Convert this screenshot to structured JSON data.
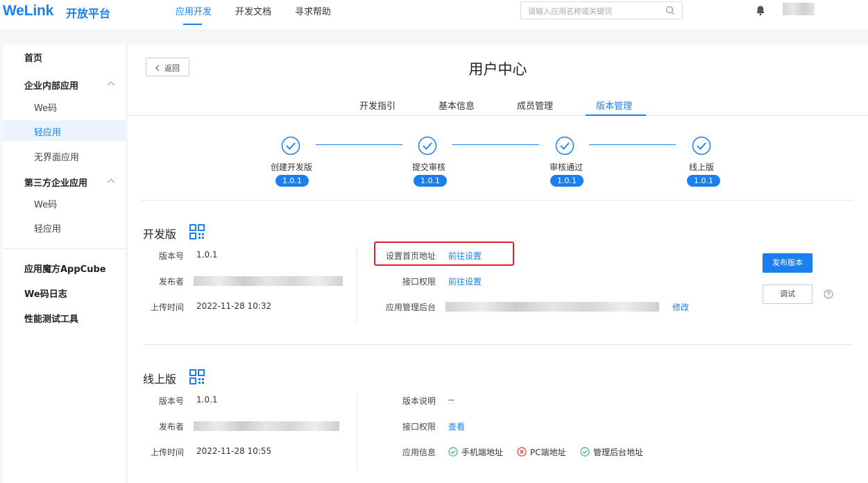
{
  "header": {
    "logo": "WeLink",
    "logo_sub": "开放平台",
    "nav": [
      "应用开发",
      "开发文档",
      "寻求帮助"
    ],
    "search_placeholder": "请输入应用名称或关键词"
  },
  "sidebar": {
    "items": [
      {
        "label": "首页"
      },
      {
        "label": "企业内部应用"
      },
      {
        "label": "We码"
      },
      {
        "label": "轻应用"
      },
      {
        "label": "无界面应用"
      },
      {
        "label": "第三方企业应用"
      },
      {
        "label": "We码"
      },
      {
        "label": "轻应用"
      },
      {
        "label": "应用魔方AppCube"
      },
      {
        "label": "We码日志"
      },
      {
        "label": "性能测试工具"
      }
    ]
  },
  "page": {
    "back": "返回",
    "title": "用户中心",
    "tabs": [
      "开发指引",
      "基本信息",
      "成员管理",
      "版本管理"
    ]
  },
  "steps": [
    {
      "label": "创建开发版",
      "version": "1.0.1"
    },
    {
      "label": "提交审核",
      "version": "1.0.1"
    },
    {
      "label": "审核通过",
      "version": "1.0.1"
    },
    {
      "label": "线上版",
      "version": "1.0.1"
    }
  ],
  "dev": {
    "title": "开发版",
    "version_label": "版本号",
    "version": "1.0.1",
    "publisher_label": "发布者",
    "upload_label": "上传时间",
    "upload_time": "2022-11-28 10:32",
    "homepage_label": "设置首页地址",
    "homepage_link": "前往设置",
    "perm_label": "接口权限",
    "perm_link": "前往设置",
    "admin_label": "应用管理后台",
    "admin_link": "修改",
    "publish_btn": "发布版本",
    "debug_btn": "调试"
  },
  "online": {
    "title": "线上版",
    "version_label": "版本号",
    "version": "1.0.1",
    "publisher_label": "发布者",
    "upload_label": "上传时间",
    "upload_time": "2022-11-28 10:55",
    "desc_label": "版本说明",
    "desc": "--",
    "perm_label": "接口权限",
    "perm_link": "查看",
    "info_label": "应用信息",
    "info": [
      {
        "label": "手机端地址",
        "status": "ok"
      },
      {
        "label": "PC端地址",
        "status": "error"
      },
      {
        "label": "管理后台地址",
        "status": "ok"
      }
    ]
  },
  "colors": {
    "accent": "#1a7ff0",
    "highlight_box": "#e02020",
    "ok": "#3cb371",
    "error": "#e53935"
  }
}
